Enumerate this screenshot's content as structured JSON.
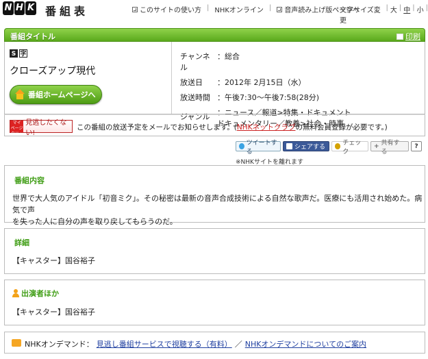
{
  "header": {
    "logo": [
      "N",
      "H",
      "K"
    ],
    "site_title": "番組表",
    "nav": [
      "このサイトの使い方",
      "NHKオンライン",
      "音声読み上げ版ページへ"
    ],
    "fontsize_label": "文字サイズ変更",
    "fontsize_options": [
      "大",
      "中",
      "小"
    ]
  },
  "titlebar": {
    "label": "番組タイトル",
    "print": "印刷"
  },
  "program": {
    "badge_s": "S",
    "badge_ji": "字",
    "title": "クローズアップ現代",
    "home_button": "番組ホームページへ"
  },
  "details": {
    "channel_key": "チャンネル",
    "channel_val": "：総合",
    "date_key": "放送日",
    "date_val": "：2012年 2月15日（水）",
    "time_key": "放送時間",
    "time_val": "：午後7:30～午後7:58(28分)",
    "genre_key": "ジャンル",
    "genre_line1": "：ニュース／報道>特集・ドキュメント",
    "genre_line2": "ドキュメンタリー／教養>社会・時事"
  },
  "notify": {
    "tag": "マイ ページ クリップ",
    "button": "見逃したくない!",
    "msg_pre": "この番組の放送予定をメールでお知らせします。(",
    "link": "NHKネットクラブ",
    "msg_post": "の無料会員登録が必要です。)"
  },
  "social": {
    "tweet": "ツイートする",
    "share_fb": "シェアする",
    "check": "チェック",
    "share": "共有する",
    "help": "?",
    "note": "※NHKサイトを離れます"
  },
  "sections": {
    "content_title": "番組内容",
    "content_body1": "世界で大人気のアイドル「初音ミク」。その秘密は最新の音声合成技術による自然な歌声だ。医療にも活用され始めた。病気で声",
    "content_body2": "を失った人に自分の声を取り戻してもらうのだ。",
    "detail_title": "詳細",
    "detail_body": "【キャスター】国谷裕子",
    "cast_title": "出演者ほか",
    "cast_body": "【キャスター】国谷裕子"
  },
  "ondemand": {
    "label": "NHKオンデマンド：",
    "link1": "見逃し番組サービスで視聴する（有料）",
    "sep": "／",
    "link2": "NHKオンデマンドについてのご案内"
  },
  "colors": {
    "accent_green": "#5aa91c",
    "link_red": "#cc2222"
  }
}
